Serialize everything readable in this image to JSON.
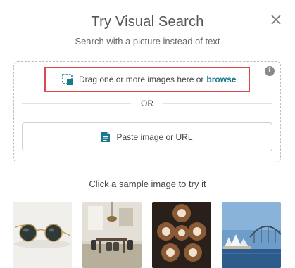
{
  "dialog": {
    "title": "Try Visual Search",
    "subtitle": "Search with a picture instead of text"
  },
  "dropzone": {
    "drag_text": "Drag one or more images here or",
    "browse_label": "browse",
    "or_label": "OR",
    "paste_label": "Paste image or URL",
    "info_glyph": "i"
  },
  "samples": {
    "heading": "Click a sample image to try it",
    "items": [
      {
        "icon": "sunglasses-image"
      },
      {
        "icon": "dining-room-image"
      },
      {
        "icon": "latte-art-image"
      },
      {
        "icon": "sydney-opera-house-image"
      }
    ]
  },
  "colors": {
    "accent": "#1a7a8c",
    "highlight_border": "#e0474c"
  }
}
